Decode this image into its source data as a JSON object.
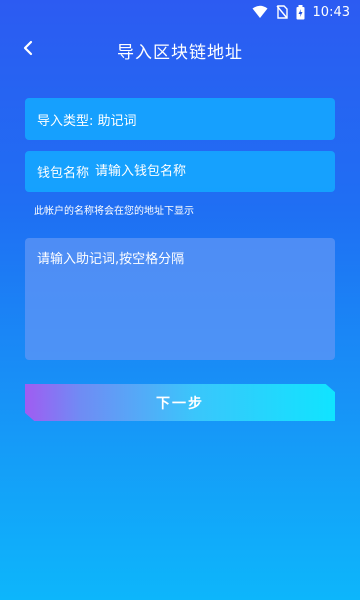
{
  "status_bar": {
    "time": "10:43",
    "icons": [
      "wifi-icon",
      "no-sim-icon",
      "battery-charging-icon"
    ]
  },
  "header": {
    "back_icon": "chevron-left-icon",
    "title": "导入区块链地址"
  },
  "form": {
    "import_type_label": "导入类型: 助记词",
    "wallet_name_label": "钱包名称",
    "wallet_name_placeholder": "请输入钱包名称",
    "wallet_name_value": "",
    "hint": "此帐户的名称将会在您的地址下显示",
    "mnemonic_placeholder": "请输入助记词,按空格分隔",
    "mnemonic_value": ""
  },
  "actions": {
    "next_label": "下一步"
  },
  "colors": {
    "bg_top": "#2c5bf2",
    "bg_bottom": "#0db6fb",
    "field_bg": "#14aaff",
    "button_start": "#a05cf2",
    "button_end": "#10e4ff"
  }
}
